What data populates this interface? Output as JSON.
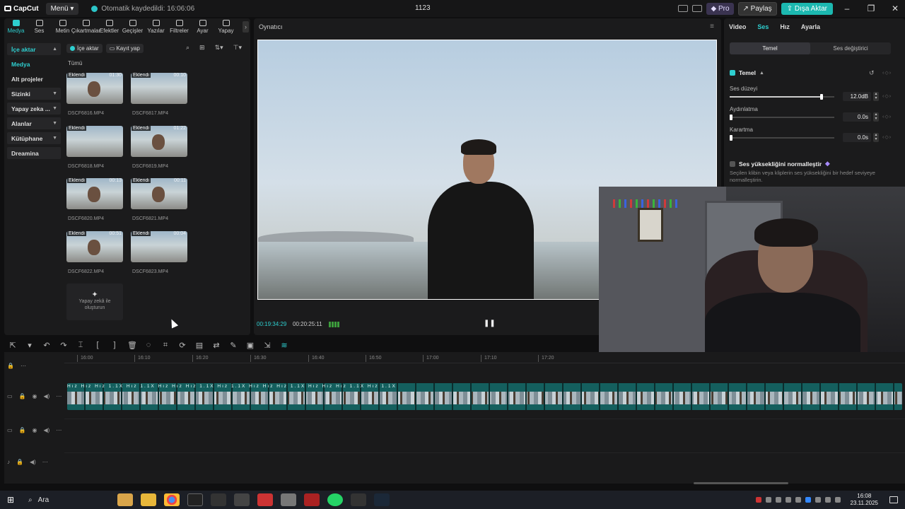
{
  "titlebar": {
    "app_name": "CapCut",
    "menu_label": "Menü",
    "autosave_text": "Otomatik kaydedildi: 16:06:06",
    "project_title": "1123",
    "pro_label": "Pro",
    "share_label": "Paylaş",
    "export_label": "Dışa Aktar",
    "accent_color": "#1cb8b0"
  },
  "toolbar_tabs": [
    "Medya",
    "Ses",
    "Metin",
    "Çıkartmalar",
    "Efektler",
    "Geçişler",
    "Yazılar",
    "Filtreler",
    "Ayar",
    "Yapay"
  ],
  "sidebar": {
    "items": [
      {
        "label": "İçe aktar",
        "caret": "▲"
      },
      {
        "label": "Medya",
        "caret": ""
      },
      {
        "label": "Alt projeler",
        "caret": ""
      },
      {
        "label": "Sizinki",
        "caret": "▼"
      },
      {
        "label": "Yapay zeka ...",
        "caret": "▼"
      },
      {
        "label": "Alanlar",
        "caret": "▼"
      },
      {
        "label": "Kütüphane",
        "caret": "▼"
      },
      {
        "label": "Dreamina",
        "caret": ""
      }
    ]
  },
  "media": {
    "import_button": "İçe aktar",
    "record_button": "Kayıt yap",
    "filter_all": "Tümü",
    "added_badge": "Eklendi",
    "clips": [
      {
        "name": "DSCF6816.MP4",
        "duration": "01:30"
      },
      {
        "name": "DSCF6817.MP4",
        "duration": "00:10"
      },
      {
        "name": "DSCF6818.MP4",
        "duration": ""
      },
      {
        "name": "DSCF6819.MP4",
        "duration": "01:22"
      },
      {
        "name": "DSCF6820.MP4",
        "duration": "00:13"
      },
      {
        "name": "DSCF6821.MP4",
        "duration": "00:11"
      },
      {
        "name": "DSCF6822.MP4",
        "duration": "00:51"
      },
      {
        "name": "DSCF6823.MP4",
        "duration": "00:04"
      }
    ],
    "ai_card_line1": "Yapay zekâ ile",
    "ai_card_line2": "oluşturun"
  },
  "player": {
    "title": "Oynatıcı",
    "current_time": "00:19:34:29",
    "total_time": "00:20:25:11"
  },
  "inspector": {
    "tabs": [
      "Video",
      "Ses",
      "Hız",
      "Ayarla"
    ],
    "active_tab": "Ses",
    "segments": [
      "Temel",
      "Ses değiştirici"
    ],
    "section_title": "Temel",
    "props": [
      {
        "label": "Ses düzeyi",
        "value": "12.0dB",
        "level": 0.88
      },
      {
        "label": "Aydınlatma",
        "value": "0.0s",
        "level": 0
      },
      {
        "label": "Karartma",
        "value": "0.0s",
        "level": 0
      }
    ],
    "normalize_label": "Ses yüksekliğini normalleştir",
    "normalize_desc": "Seçilen klibin veya kliplerin ses yüksekliğini bir hedef seviyeye normalleştirin."
  },
  "timeline": {
    "ruler": [
      "16:00",
      "16:10",
      "16:20",
      "16:30",
      "16:40",
      "16:50",
      "17:00",
      "17:10",
      "17:20"
    ],
    "clip_labels": "Hız Hız Hız 1.1X Hız 1.1X Hız Hız Hız 1.1X Hız 1.1X Hız Hız Hız 1.1X Hız Hız Hız 1.1X Hız 1.1X"
  },
  "taskbar": {
    "search_label": "Ara",
    "time": "16:08",
    "date": "23.11.2025"
  }
}
